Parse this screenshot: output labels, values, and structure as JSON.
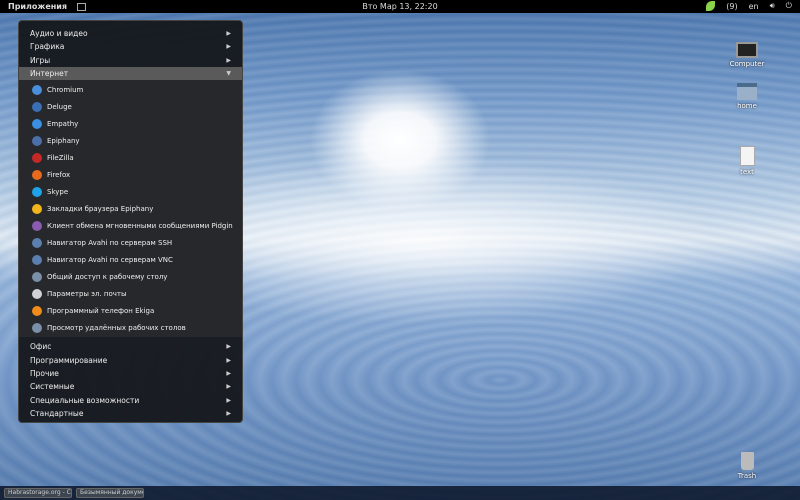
{
  "topbar": {
    "apps": "Приложения",
    "clock": "Вто Мар 13, 22:20",
    "notifications": "(9)",
    "lang": "en"
  },
  "menu": {
    "top": [
      {
        "label": "Аудио и видео"
      },
      {
        "label": "Графика"
      },
      {
        "label": "Игры"
      },
      {
        "label": "Интернет"
      }
    ],
    "internet": [
      {
        "label": "Chromium",
        "color": "#4a8fd9"
      },
      {
        "label": "Deluge",
        "color": "#3a6fb5"
      },
      {
        "label": "Empathy",
        "color": "#3b8fe0"
      },
      {
        "label": "Epiphany",
        "color": "#4d6fa8"
      },
      {
        "label": "FileZilla",
        "color": "#c62828"
      },
      {
        "label": "Firefox",
        "color": "#e86a1c"
      },
      {
        "label": "Skype",
        "color": "#1fa3e8"
      },
      {
        "label": "Закладки браузера Epiphany",
        "color": "#f2b51c"
      },
      {
        "label": "Клиент обмена мгновенными сообщениями Pidgin",
        "color": "#8a5cb0"
      },
      {
        "label": "Навигатор Avahi по серверам SSH",
        "color": "#5b7fae"
      },
      {
        "label": "Навигатор Avahi по серверам VNC",
        "color": "#5b7fae"
      },
      {
        "label": "Общий доступ к рабочему столу",
        "color": "#7a8fa8"
      },
      {
        "label": "Параметры эл. почты",
        "color": "#cfd3d8"
      },
      {
        "label": "Программный телефон Ekiga",
        "color": "#f08c1a"
      },
      {
        "label": "Просмотр удалённых рабочих столов",
        "color": "#7a8fa8"
      }
    ],
    "bottom": [
      {
        "label": "Офис"
      },
      {
        "label": "Программирование"
      },
      {
        "label": "Прочие"
      },
      {
        "label": "Системные"
      },
      {
        "label": "Специальные возможности"
      },
      {
        "label": "Стандартные"
      }
    ]
  },
  "desktop": [
    {
      "label": "Computer"
    },
    {
      "label": "home"
    },
    {
      "label": "text"
    },
    {
      "label": "Trash"
    }
  ],
  "taskbar": [
    {
      "label": "Habrastorage.org - C..."
    },
    {
      "label": "Безымянный докуме..."
    }
  ]
}
